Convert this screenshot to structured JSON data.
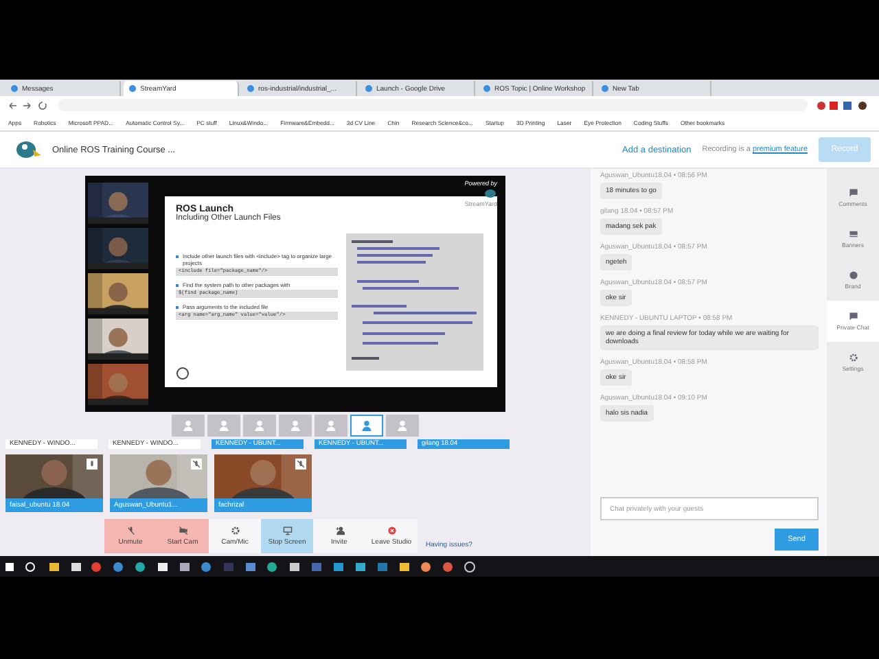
{
  "browser": {
    "tabs": [
      {
        "title": "Messages",
        "selected": false
      },
      {
        "title": "StreamYard",
        "selected": true
      },
      {
        "title": "ros-industrial/industrial_...",
        "selected": false
      },
      {
        "title": "Launch - Google Drive",
        "selected": false
      },
      {
        "title": "ROS Topic | Online Workshop",
        "selected": false
      },
      {
        "title": "New Tab",
        "selected": false
      }
    ],
    "bookmarks": [
      "Apps",
      "Robotics",
      "Microsoft PPAD...",
      "Automatic Control Sy...",
      "PC stuff",
      "Linux&Windo...",
      "Firmware&Embedd...",
      "3d CV Line",
      "Chin",
      "Research Science&co...",
      "Startup",
      "3D Printing",
      "Laser",
      "Eye Protection",
      "Coding Stuffs",
      "Other bookmarks"
    ]
  },
  "header": {
    "title": "Online ROS Training Course ...",
    "add_destination": "Add a destination",
    "recording_note": "Recording is a",
    "recording_link": "premium feature",
    "record_button": "Record"
  },
  "stage": {
    "powered_by": "Powered by",
    "brand": "StreamYard",
    "slide": {
      "title": "ROS Launch",
      "subtitle": "Including Other Launch Files",
      "bullets": [
        {
          "text": "Include other launch files with <include> tag to organize large projects",
          "code": "<include file=\"package_name\"/>"
        },
        {
          "text": "Find the system path to other packages with",
          "code": "$(find package_name)"
        },
        {
          "text": "Pass arguments to the included file",
          "code": "<arg name=\"arg_name\" value=\"value\"/>"
        }
      ]
    }
  },
  "layouts": [
    {
      "selected": false
    },
    {
      "selected": false
    },
    {
      "selected": false
    },
    {
      "selected": false
    },
    {
      "selected": false
    },
    {
      "selected": true
    },
    {
      "selected": false
    }
  ],
  "guests": [
    {
      "name": "KENNEDY - WINDO...",
      "on_stage": false
    },
    {
      "name": "KENNEDY - WINDO...",
      "on_stage": false
    },
    {
      "name": "KENNEDY - UBUNT...",
      "on_stage": true
    },
    {
      "name": "KENNEDY - UBUNT...",
      "on_stage": true
    },
    {
      "name": "gilang 18.04",
      "on_stage": true
    }
  ],
  "videos": [
    {
      "name": "faisal_ubuntu 18.04",
      "muted": false
    },
    {
      "name": "Aguswan_Ubuntu1...",
      "muted": true
    },
    {
      "name": "fachrizal",
      "muted": true
    }
  ],
  "controls": [
    {
      "label": "Unmute",
      "kind": "off"
    },
    {
      "label": "Start Cam",
      "kind": "off"
    },
    {
      "label": "Cam/Mic",
      "kind": "plain"
    },
    {
      "label": "Stop Screen",
      "kind": "active"
    },
    {
      "label": "Invite",
      "kind": "plain"
    },
    {
      "label": "Leave Studio",
      "kind": "plain"
    }
  ],
  "having_issues": "Having issues?",
  "chat": {
    "messages": [
      {
        "meta": "Aguswan_Ubuntu18.04 • 08:56 PM",
        "text": "18 minutes to go"
      },
      {
        "meta": "gilang 18.04 • 08:57 PM",
        "text": "madang sek pak"
      },
      {
        "meta": "Aguswan_Ubuntu18.04 • 08:57 PM",
        "text": "ngeteh"
      },
      {
        "meta": "Aguswan_Ubuntu18.04 • 08:57 PM",
        "text": "oke sir"
      },
      {
        "meta": "KENNEDY - UBUNTU LAPTOP • 08:58 PM",
        "text": "we are doing a final review for today while we are waiting for downloads"
      },
      {
        "meta": "Aguswan_Ubuntu18.04 • 08:58 PM",
        "text": "oke sir"
      },
      {
        "meta": "Aguswan_Ubuntu18.04 • 09:10 PM",
        "text": "halo sis nadia"
      }
    ],
    "placeholder": "Chat privately with your guests",
    "send": "Send"
  },
  "sidebar": [
    {
      "label": "Comments",
      "selected": false
    },
    {
      "label": "Banners",
      "selected": false
    },
    {
      "label": "Brand",
      "selected": false
    },
    {
      "label": "Private Chat",
      "selected": true
    },
    {
      "label": "Settings",
      "selected": false
    }
  ]
}
